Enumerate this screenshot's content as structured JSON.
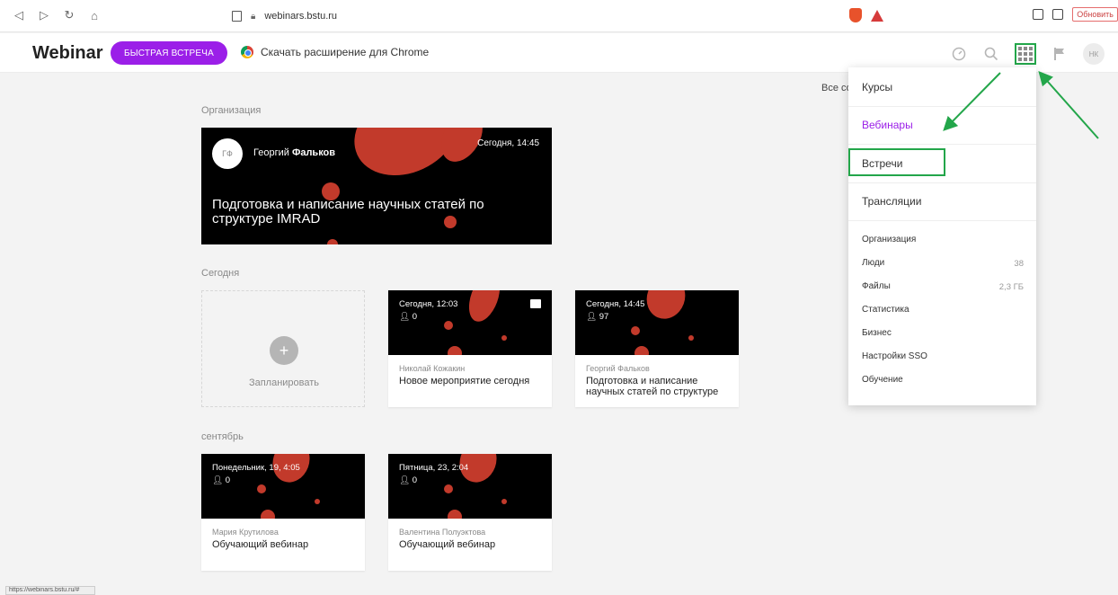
{
  "browser": {
    "url": "webinars.bstu.ru",
    "update_label": "Обновить",
    "status_url": "https://webinars.bstu.ru/#"
  },
  "header": {
    "logo": "Webinar",
    "quick_meeting": "БЫСТРАЯ ВСТРЕЧА",
    "chrome_extension": "Скачать расширение для Chrome",
    "avatar_initials": "НК"
  },
  "main": {
    "all_label": "Все со",
    "org_section": "Организация",
    "featured": {
      "avatar_initials": "ГФ",
      "author_first": "Георгий",
      "author_last": "Фальков",
      "time": "Сегодня, 14:45",
      "title": "Подготовка и написание научных статей по структуре IMRAD"
    },
    "today_section": "Сегодня",
    "plan_label": "Запланировать",
    "today_cards": [
      {
        "time": "Сегодня, 12:03",
        "count": "0",
        "author": "Николай Кожакин",
        "title": "Новое мероприятие сегодня"
      },
      {
        "time": "Сегодня, 14:45",
        "count": "97",
        "author": "Георгий Фальков",
        "title": "Подготовка и написание научных статей по структуре"
      }
    ],
    "september_section": "сентябрь",
    "september_cards": [
      {
        "time": "Понедельник, 19, 4:05",
        "count": "0",
        "author": "Мария Крутилова",
        "title": "Обучающий вебинар"
      },
      {
        "time": "Пятница, 23, 2:04",
        "count": "0",
        "author": "Валентина Полуэктова",
        "title": "Обучающий вебинар"
      }
    ]
  },
  "menu": {
    "items": [
      "Курсы",
      "Вебинары",
      "Встречи",
      "Трансляции"
    ],
    "admin": [
      {
        "label": "Организация",
        "count": ""
      },
      {
        "label": "Люди",
        "count": "38"
      },
      {
        "label": "Файлы",
        "count": "2,3 ГБ"
      },
      {
        "label": "Статистика",
        "count": ""
      },
      {
        "label": "Бизнес",
        "count": ""
      },
      {
        "label": "Настройки SSO",
        "count": ""
      },
      {
        "label": "Обучение",
        "count": ""
      }
    ]
  },
  "colors": {
    "accent": "#9b1fe8",
    "highlight": "#23a64a",
    "blob": "#c23a2b"
  }
}
